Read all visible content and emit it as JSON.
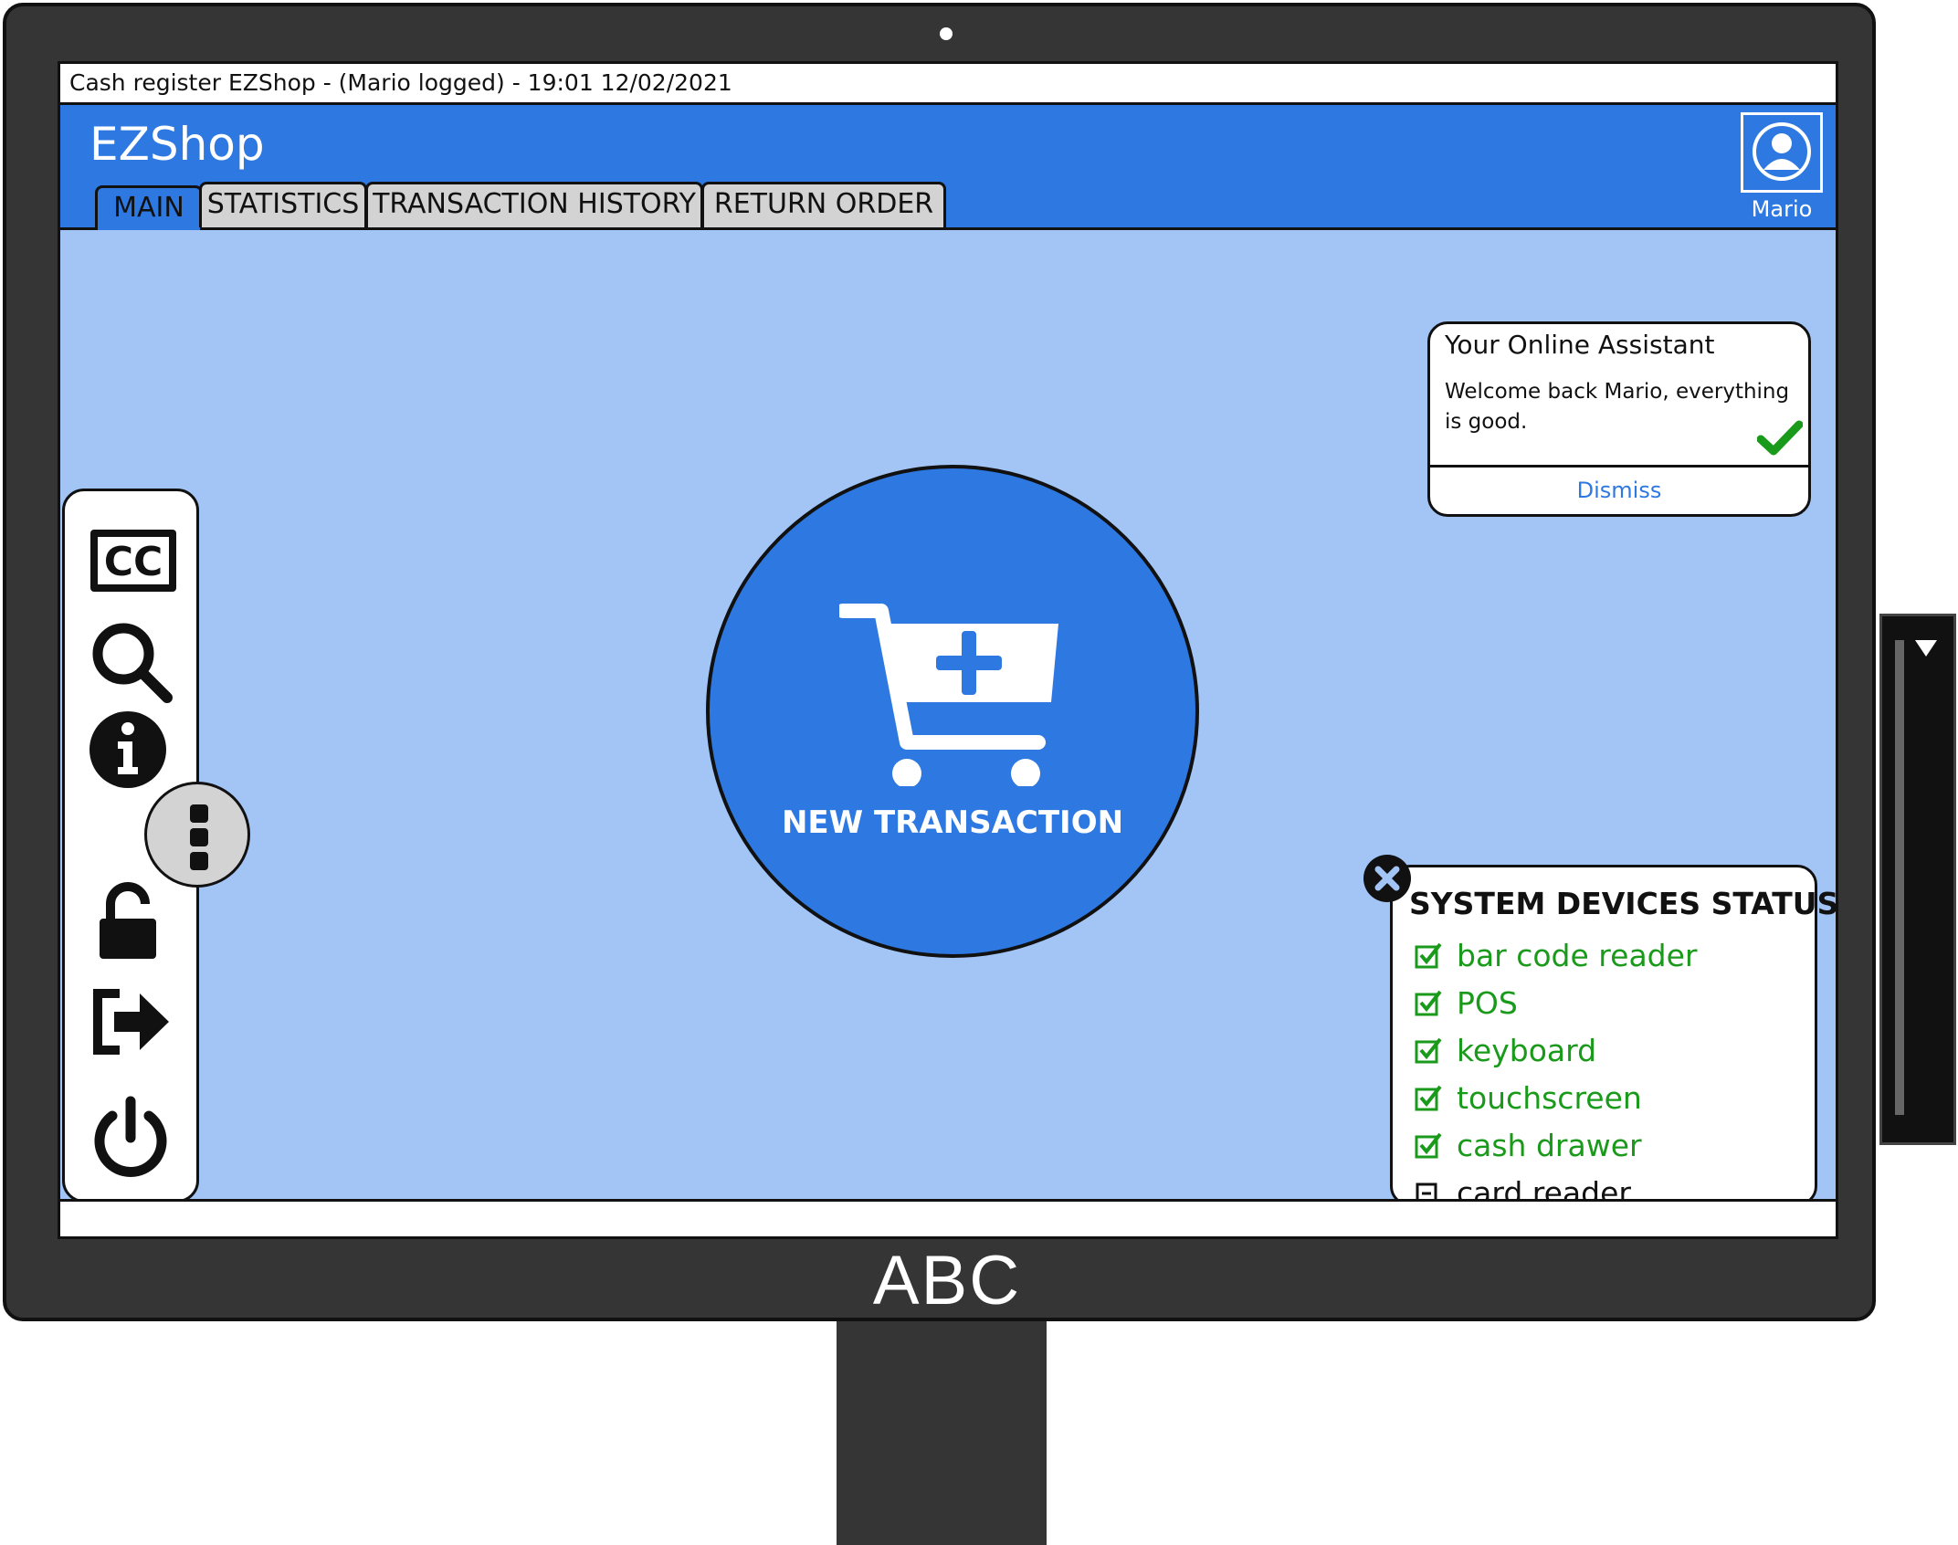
{
  "window": {
    "title": "Cash register EZShop - (Mario logged) - 19:01 12/02/2021"
  },
  "header": {
    "app_name": "EZShop",
    "tabs": [
      {
        "label": "MAIN",
        "active": true
      },
      {
        "label": "STATISTICS",
        "active": false
      },
      {
        "label": "TRANSACTION HISTORY",
        "active": false
      },
      {
        "label": "RETURN ORDER",
        "active": false
      }
    ],
    "user": {
      "name": "Mario",
      "icon": "user-avatar-icon"
    }
  },
  "sidebar": {
    "icons": [
      "closed-captions-icon",
      "search-icon",
      "info-icon",
      "more-vertical-icon",
      "unlock-icon",
      "logout-icon",
      "power-icon"
    ]
  },
  "main": {
    "new_transaction": {
      "label": "NEW TRANSACTION",
      "icon": "cart-plus-icon"
    }
  },
  "assistant": {
    "title": "Your Online Assistant",
    "message": "Welcome back Mario, everything is good.",
    "dismiss_label": "Dismiss",
    "status_icon": "checkmark-icon"
  },
  "device_status": {
    "title": "SYSTEM DEVICES STATUS",
    "devices": [
      {
        "name": "bar code reader",
        "status": "ok"
      },
      {
        "name": "POS",
        "status": "ok"
      },
      {
        "name": "keyboard",
        "status": "ok"
      },
      {
        "name": "touchscreen",
        "status": "ok"
      },
      {
        "name": "cash drawer",
        "status": "ok"
      },
      {
        "name": "card reader",
        "status": "unavailable"
      }
    ]
  },
  "monitor": {
    "brand": "ABC"
  },
  "colors": {
    "primary": "#2e78e2",
    "content_bg": "#a2c5f6",
    "ok_green": "#1a9a1a",
    "bezel": "#353535",
    "tab_inactive": "#d3d3d3"
  }
}
